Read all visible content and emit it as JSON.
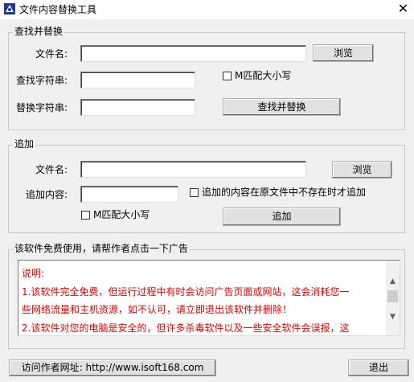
{
  "window": {
    "title": "文件内容替换工具",
    "close_glyph": "✕",
    "app_icon": "app-logo-icon"
  },
  "find_replace": {
    "group_title": "查找并替换",
    "file_label": "文件名:",
    "file_value": "",
    "browse_label": "浏览",
    "find_label": "查找字符串:",
    "find_value": "",
    "match_case_label": "M匹配大小写",
    "match_case_checked": false,
    "replace_label": "替换字符串:",
    "replace_value": "",
    "action_label": "查找并替换"
  },
  "append": {
    "group_title": "追加",
    "file_label": "文件名:",
    "file_value": "",
    "browse_label": "浏览",
    "content_label": "追加内容:",
    "content_value": "",
    "only_if_absent_label": "追加的内容在原文件中不存在时才追加",
    "only_if_absent_checked": false,
    "match_case_label": "M匹配大小写",
    "match_case_checked": false,
    "action_label": "追加"
  },
  "ad": {
    "group_title": "该软件免费使用，请帮作者点击一下广告",
    "lines": [
      "说明:",
      "1.该软件完全免费，但运行过程中有时会访问广告页面或网站，这会消耗您一",
      "些网络流量和主机资源，如不认可，请立即退出该软件并删除！",
      "2.该软件对您的电脑是安全的，但许多杀毒软件以及一些安全软件会误报，这"
    ],
    "text_color": "#e00000"
  },
  "footer": {
    "author_site_label": "访问作者网址: http://www.isoft168.com",
    "exit_label": "退出"
  }
}
